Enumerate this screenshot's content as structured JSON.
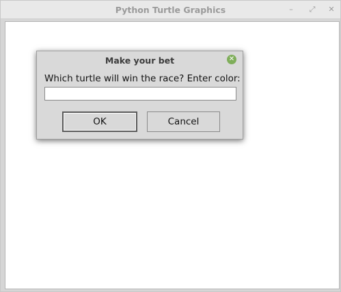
{
  "window": {
    "title": "Python Turtle Graphics",
    "minimize_glyph": "–",
    "maximize_glyph": "⤢",
    "close_glyph": "✕"
  },
  "dialog": {
    "title": "Make your bet",
    "close_glyph": "✕",
    "prompt": "Which turtle will win the race? Enter color:",
    "input_value": "",
    "ok_label": "OK",
    "cancel_label": "Cancel",
    "close_icon_color": "#7fae5a"
  }
}
